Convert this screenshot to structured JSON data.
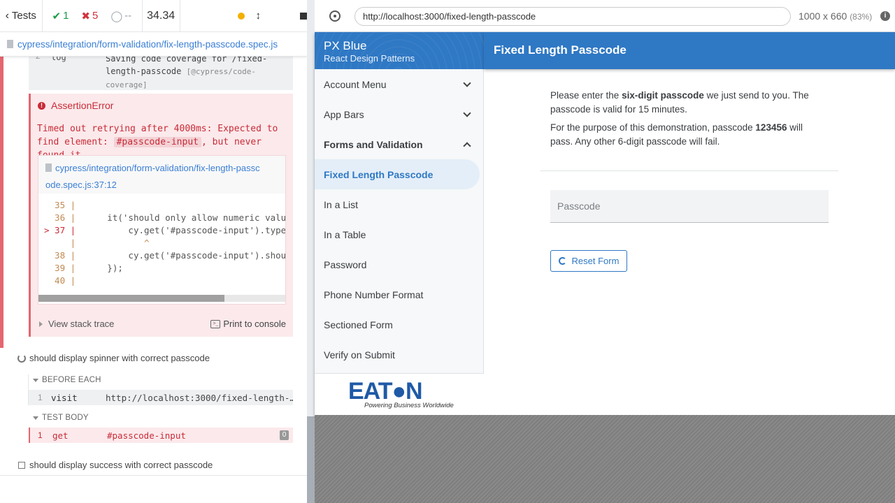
{
  "runner": {
    "header": {
      "tests_label": "Tests",
      "passed": "1",
      "failed": "5",
      "pending": "--",
      "duration": "34.34"
    },
    "spec_path": "cypress/integration/form-validation/fix-length-passcode.spec.js",
    "prev_log": {
      "num": "2",
      "cmd": "log",
      "msg": "Saving code coverage for /fixed-length-passcode",
      "msg_dim": "[@cypress/code-coverage]"
    },
    "error": {
      "title": "AssertionError",
      "msg_pre": "Timed out retrying after 4000ms: Expected to find element: ",
      "msg_code": "#passcode-input",
      "msg_post": ", but never found it.",
      "file_line1": "cypress/integration/form-validation/fix-length-passc",
      "file_line2": "ode.spec.js:37:12",
      "code_lines": [
        {
          "gutter": "  35 |",
          "code": ""
        },
        {
          "gutter": "  36 |",
          "code": "    it('should only allow numeric valu"
        },
        {
          "gutter": "> 37 |",
          "code": "        cy.get('#passcode-input').type"
        },
        {
          "gutter": "     |",
          "code": "           ^"
        },
        {
          "gutter": "  38 |",
          "code": "        cy.get('#passcode-input').shou"
        },
        {
          "gutter": "  39 |",
          "code": "    });"
        },
        {
          "gutter": "  40 |",
          "code": ""
        }
      ],
      "stack_label": "View stack trace",
      "console_label": "Print to console"
    },
    "test2": {
      "title": "should display spinner with correct passcode",
      "before_each": "BEFORE EACH",
      "visit": {
        "num": "1",
        "cmd": "visit",
        "value": "http://localhost:3000/fixed-length-…"
      },
      "test_body": "TEST BODY",
      "get": {
        "num": "1",
        "cmd": "get",
        "value": "#passcode-input",
        "badge": "0"
      }
    },
    "test3": {
      "title": "should display success with correct passcode"
    }
  },
  "aut_bar": {
    "url": "http://localhost:3000/fixed-length-passcode",
    "viewport": "1000 x 660",
    "scale": "(83%)"
  },
  "app": {
    "drawer_title": "PX Blue",
    "drawer_subtitle": "React Design Patterns",
    "nav": [
      {
        "label": "Account Menu"
      },
      {
        "label": "App Bars"
      },
      {
        "label": "Forms and Validation"
      },
      {
        "label": "Fixed Length Passcode"
      },
      {
        "label": "In a List"
      },
      {
        "label": "In a Table"
      },
      {
        "label": "Password"
      },
      {
        "label": "Phone Number Format"
      },
      {
        "label": "Sectioned Form"
      },
      {
        "label": "Verify on Submit"
      }
    ],
    "logo_text": "EAT●N",
    "logo_tagline": "Powering Business Worldwide",
    "page_title": "Fixed Length Passcode",
    "intro_pre": "Please enter the ",
    "intro_bold": "six-digit passcode",
    "intro_post": " we just send to you. The passcode is valid for 15 minutes.",
    "demo_pre": "For the purpose of this demonstration, passcode ",
    "demo_bold": "123456",
    "demo_post": " will pass. Any other 6-digit passcode will fail.",
    "passcode_placeholder": "Passcode",
    "reset_label": "Reset Form"
  },
  "colors": {
    "primary": "#2f78c4",
    "fail": "#c92b37",
    "pass": "#1c9b4a"
  }
}
